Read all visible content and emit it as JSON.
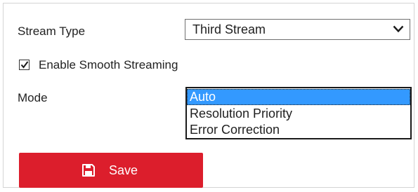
{
  "stream_type": {
    "label": "Stream Type",
    "selected_value": "Third Stream"
  },
  "smooth_streaming": {
    "label": "Enable Smooth Streaming",
    "checked": true
  },
  "mode": {
    "label": "Mode",
    "options": [
      "Auto",
      "Resolution Priority",
      "Error Correction"
    ],
    "selected_index": 0
  },
  "save_button": {
    "label": "Save",
    "icon": "floppy-disk-icon"
  },
  "colors": {
    "save_button": "#dc1e2c",
    "selected_option": "#3399ff",
    "panel_border": "#d4d4d4"
  }
}
